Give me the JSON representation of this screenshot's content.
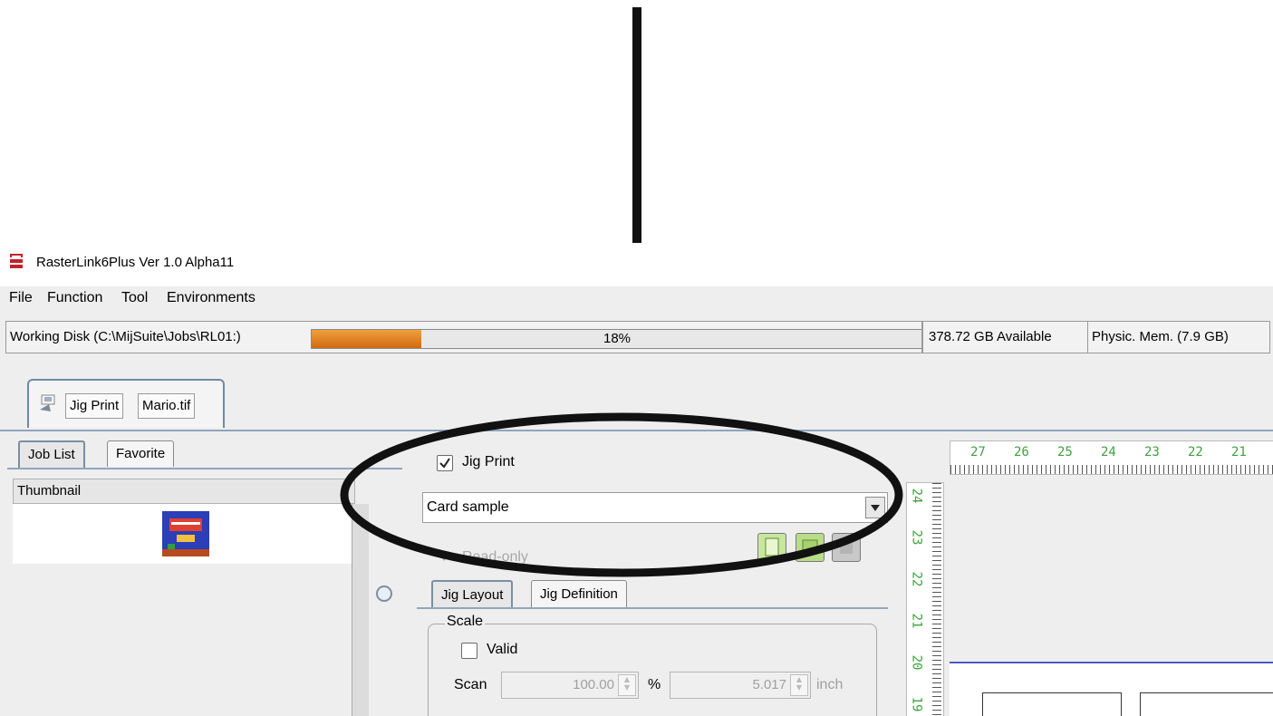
{
  "window": {
    "title": "RasterLink6Plus Ver 1.0 Alpha11"
  },
  "menu": [
    "File",
    "Function",
    "Tool",
    "Environments"
  ],
  "status": {
    "disk_label": "Working Disk (C:\\MijSuite\\Jobs\\RL01:)",
    "disk_usage": "18%",
    "disk_usage_fraction": 0.18,
    "available": "378.72 GB Available",
    "memory": "Physic. Mem. (7.9 GB)"
  },
  "doc_tab": {
    "function": "Jig Print",
    "file": "Mario.tif"
  },
  "left_tabs": [
    "Job List",
    "Favorite"
  ],
  "thumbnail_header": "Thumbnail",
  "jig": {
    "enabled_label": "Jig Print",
    "preset": "Card sample",
    "read_only": "Read-only"
  },
  "inner_tabs": [
    "Jig Layout",
    "Jig Definition"
  ],
  "scale": {
    "group_label": "Scale",
    "valid_label": "Valid",
    "scan_label": "Scan",
    "percent_value": "100.00",
    "percent_unit": "%",
    "inch_value": "5.017",
    "inch_unit": "inch"
  },
  "ruler": {
    "h_ticks": [
      "27",
      "26",
      "25",
      "24",
      "23",
      "22",
      "21"
    ],
    "v_ticks": [
      "24",
      "23",
      "22",
      "21",
      "20",
      "19"
    ]
  },
  "colors": {
    "accent": "#d06a10",
    "ruler_text": "#3fa13f",
    "annotation": "#111111"
  }
}
